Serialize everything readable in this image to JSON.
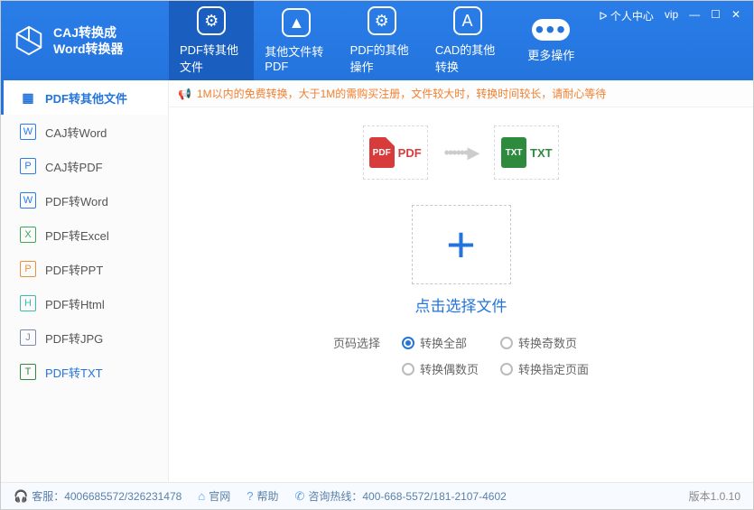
{
  "brand": {
    "line1": "CAJ转换成",
    "line2": "Word转换器"
  },
  "tabs": [
    {
      "label": "PDF转其他文件"
    },
    {
      "label": "其他文件转PDF"
    },
    {
      "label": "PDF的其他操作"
    },
    {
      "label": "CAD的其他转换"
    },
    {
      "label": "更多操作"
    }
  ],
  "window": {
    "user_center": "个人中心",
    "vip": "vip"
  },
  "sidebar": {
    "header": "PDF转其他文件",
    "items": [
      {
        "label": "CAJ转Word",
        "color": "#2a7de8"
      },
      {
        "label": "CAJ转PDF",
        "color": "#2a7de8"
      },
      {
        "label": "PDF转Word",
        "color": "#2a7de8"
      },
      {
        "label": "PDF转Excel",
        "color": "#3aa855"
      },
      {
        "label": "PDF转PPT",
        "color": "#e8913a"
      },
      {
        "label": "PDF转Html",
        "color": "#3abca8"
      },
      {
        "label": "PDF转JPG",
        "color": "#7a8aa8"
      },
      {
        "label": "PDF转TXT",
        "color": "#2e8b3e"
      }
    ]
  },
  "notice": "1M以内的免费转换，大于1M的需购买注册，文件较大时，转换时间较长，请耐心等待",
  "convert": {
    "from": "PDF",
    "to": "TXT"
  },
  "dropzone": {
    "label": "点击选择文件"
  },
  "options": {
    "title": "页码选择",
    "all": "转换全部",
    "even": "转换偶数页",
    "odd": "转换奇数页",
    "custom": "转换指定页面"
  },
  "footer": {
    "service": "客服：4006685572/326231478",
    "website": "官网",
    "help": "帮助",
    "hotline": "咨询热线：400-668-5572/181-2107-4602",
    "version": "版本1.0.10"
  }
}
